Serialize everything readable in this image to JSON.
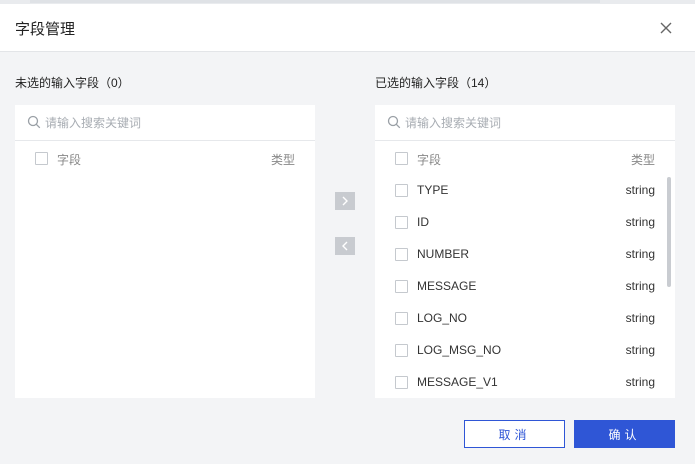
{
  "dialog": {
    "title": "字段管理",
    "close_icon": "close-icon"
  },
  "left_panel": {
    "title": "未选的输入字段（0）",
    "search_placeholder": "请输入搜索关键词",
    "header": {
      "name": "字段",
      "type": "类型"
    },
    "items": []
  },
  "transfer": {
    "move_right_icon": "chevron-right-icon",
    "move_left_icon": "chevron-left-icon"
  },
  "right_panel": {
    "title": "已选的输入字段（14）",
    "search_placeholder": "请输入搜索关键词",
    "header": {
      "name": "字段",
      "type": "类型"
    },
    "items": [
      {
        "name": "TYPE",
        "type": "string"
      },
      {
        "name": "ID",
        "type": "string"
      },
      {
        "name": "NUMBER",
        "type": "string"
      },
      {
        "name": "MESSAGE",
        "type": "string"
      },
      {
        "name": "LOG_NO",
        "type": "string"
      },
      {
        "name": "LOG_MSG_NO",
        "type": "string"
      },
      {
        "name": "MESSAGE_V1",
        "type": "string"
      }
    ]
  },
  "footer": {
    "cancel_label": "取消",
    "confirm_label": "确认"
  },
  "colors": {
    "primary": "#2f56d6",
    "background": "#f3f4f6"
  }
}
